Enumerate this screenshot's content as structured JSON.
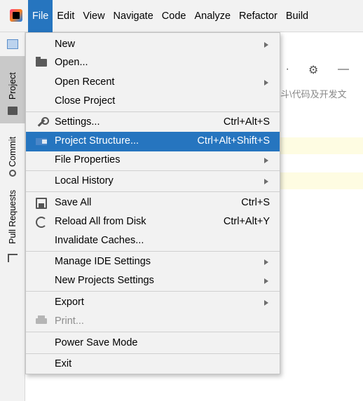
{
  "menubar": {
    "items": [
      {
        "label": "File"
      },
      {
        "label": "Edit"
      },
      {
        "label": "View"
      },
      {
        "label": "Navigate"
      },
      {
        "label": "Code"
      },
      {
        "label": "Analyze"
      },
      {
        "label": "Refactor"
      },
      {
        "label": "Build"
      }
    ]
  },
  "sidebar": {
    "tabs": [
      {
        "label": "Project"
      },
      {
        "label": "Commit"
      },
      {
        "label": "Pull Requests"
      }
    ]
  },
  "background": {
    "path_text": "斗\\代码及开发文"
  },
  "file_menu": {
    "items": [
      {
        "label": "New",
        "submenu": true
      },
      {
        "label": "Open...",
        "icon": "folder-open-icon"
      },
      {
        "label": "Open Recent",
        "submenu": true
      },
      {
        "label": "Close Project"
      },
      {
        "label": "Settings...",
        "shortcut": "Ctrl+Alt+S",
        "icon": "wrench-icon"
      },
      {
        "label": "Project Structure...",
        "shortcut": "Ctrl+Alt+Shift+S",
        "icon": "project-structure-icon",
        "highlighted": true
      },
      {
        "label": "File Properties",
        "submenu": true
      },
      {
        "label": "Local History",
        "submenu": true
      },
      {
        "label": "Save All",
        "shortcut": "Ctrl+S",
        "icon": "save-icon"
      },
      {
        "label": "Reload All from Disk",
        "shortcut": "Ctrl+Alt+Y",
        "icon": "reload-icon"
      },
      {
        "label": "Invalidate Caches..."
      },
      {
        "label": "Manage IDE Settings",
        "submenu": true
      },
      {
        "label": "New Projects Settings",
        "submenu": true
      },
      {
        "label": "Export",
        "submenu": true
      },
      {
        "label": "Print...",
        "icon": "print-icon",
        "disabled": true
      },
      {
        "label": "Power Save Mode"
      },
      {
        "label": "Exit"
      }
    ]
  }
}
